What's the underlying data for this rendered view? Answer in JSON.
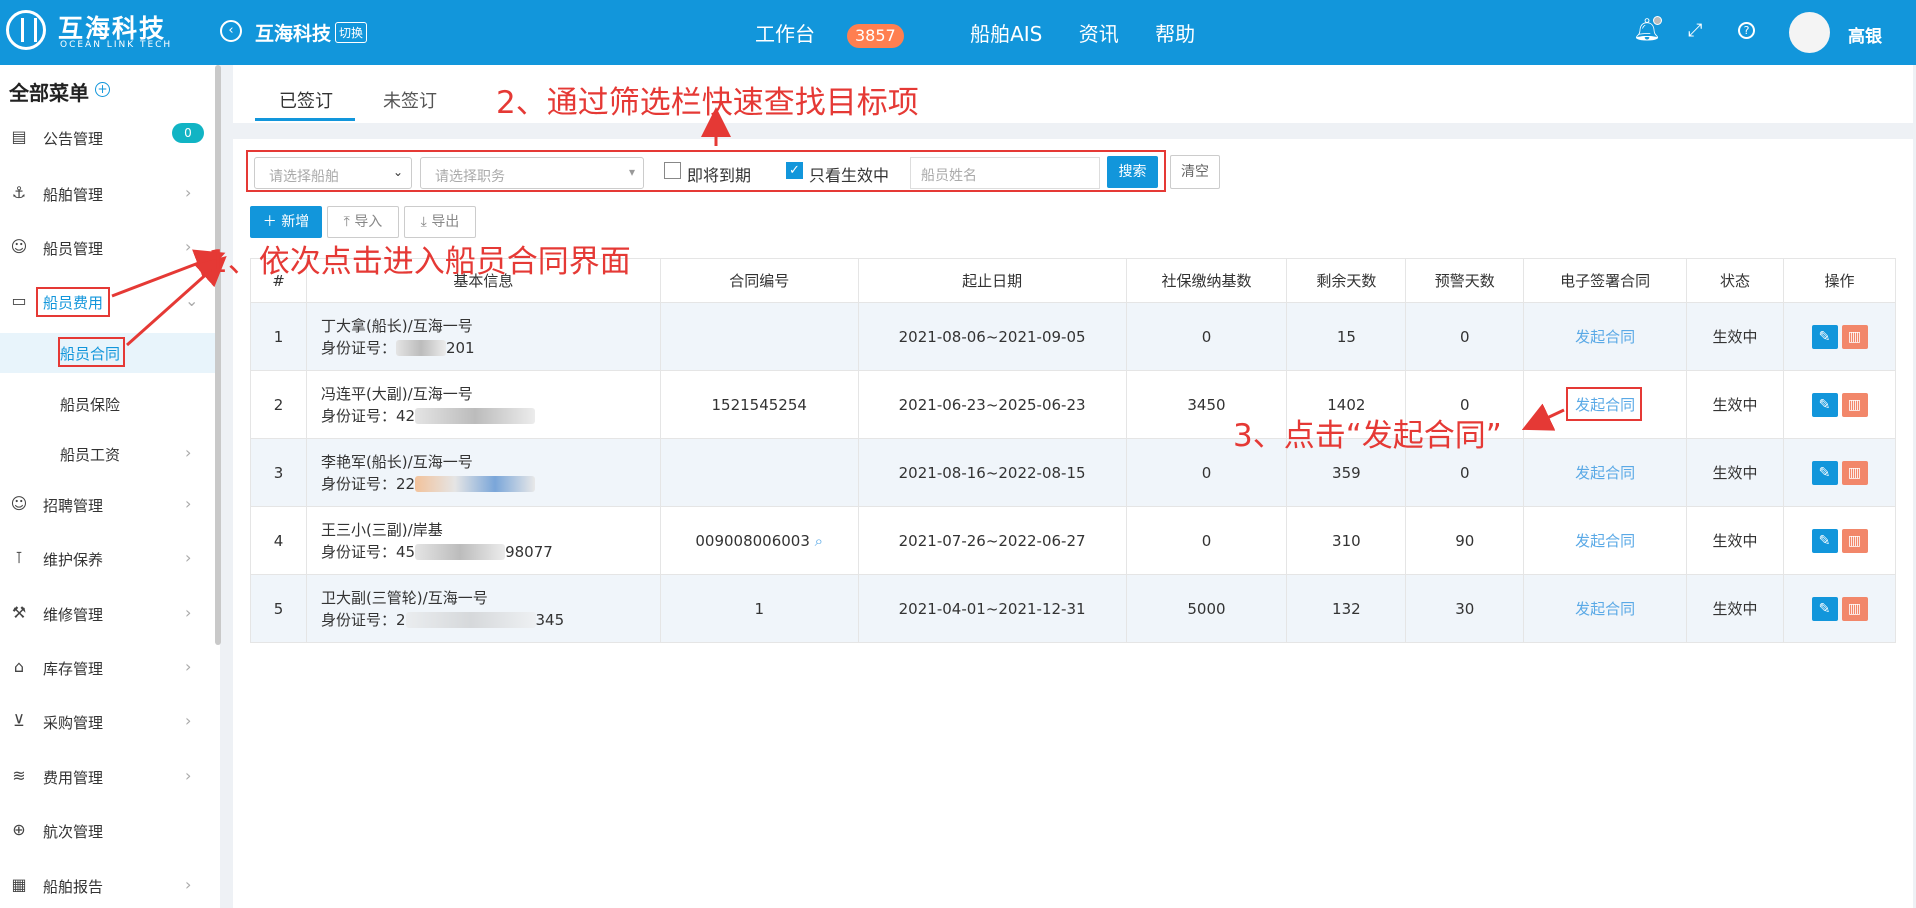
{
  "header": {
    "brand": "互海科技",
    "brand_sub": "OCEAN LINK TECH",
    "company": "互海科技",
    "switch_label": "切换",
    "nav": [
      {
        "label": "工作台",
        "badge": "3857"
      },
      {
        "label": "船舶AIS"
      },
      {
        "label": "资讯"
      },
      {
        "label": "帮助"
      }
    ],
    "username": "高银",
    "icons": {
      "back": "back-circle-icon",
      "bell": "bell-icon",
      "expand": "expand-icon",
      "help": "help-icon"
    }
  },
  "sidebar": {
    "title": "全部菜单",
    "items": [
      {
        "label": "公告管理",
        "icon": "book-icon",
        "badge": "0"
      },
      {
        "label": "船舶管理",
        "icon": "anchor-icon"
      },
      {
        "label": "船员管理",
        "icon": "user-icon"
      },
      {
        "label": "船员费用",
        "icon": "wallet-icon"
      },
      {
        "label": "船员合同"
      },
      {
        "label": "船员保险"
      },
      {
        "label": "船员工资"
      },
      {
        "label": "招聘管理",
        "icon": "recruit-icon"
      },
      {
        "label": "维护保养",
        "icon": "maintain-icon"
      },
      {
        "label": "维修管理",
        "icon": "wrench-icon"
      },
      {
        "label": "库存管理",
        "icon": "home-icon"
      },
      {
        "label": "采购管理",
        "icon": "cart-icon"
      },
      {
        "label": "费用管理",
        "icon": "coins-icon"
      },
      {
        "label": "航次管理",
        "icon": "globe-icon"
      },
      {
        "label": "船舶报告",
        "icon": "report-icon"
      }
    ]
  },
  "tabs": [
    "已签订",
    "未签订"
  ],
  "filters": {
    "ship_placeholder": "请选择船舶",
    "duty_placeholder": "请选择职务",
    "expiring_label": "即将到期",
    "active_only_label": "只看生效中",
    "name_placeholder": "船员姓名",
    "search_label": "搜索",
    "clear_label": "清空"
  },
  "actions": {
    "add": "新增",
    "import": "导入",
    "export": "导出"
  },
  "table": {
    "headers": [
      "#",
      "基本信息",
      "合同编号",
      "起止日期",
      "社保缴纳基数",
      "剩余天数",
      "预警天数",
      "电子签署合同",
      "状态",
      "操作"
    ],
    "rows": [
      {
        "no": "1",
        "name": "丁大拿(船长)/互海一号",
        "id_label": "身份证号：",
        "id_tail": "201",
        "contract": "",
        "period": "2021-08-06~2021-09-05",
        "social": "0",
        "remain": "15",
        "warn": "0",
        "esign": "发起合同",
        "status": "生效中"
      },
      {
        "no": "2",
        "name": "冯连平(大副)/互海一号",
        "id_label": "身份证号：",
        "id_head": "42",
        "contract": "1521545254",
        "period": "2021-06-23~2025-06-23",
        "social": "3450",
        "remain": "1402",
        "warn": "0",
        "esign": "发起合同",
        "status": "生效中"
      },
      {
        "no": "3",
        "name": "李艳军(船长)/互海一号",
        "id_label": "身份证号：",
        "id_head": "22",
        "contract": "",
        "period": "2021-08-16~2022-08-15",
        "social": "0",
        "remain": "359",
        "warn": "0",
        "esign": "发起合同",
        "status": "生效中"
      },
      {
        "no": "4",
        "name": "王三小(三副)/岸基",
        "id_label": "身份证号：",
        "id_head": "45",
        "id_tail": "98077",
        "contract": "009008006003",
        "period": "2021-07-26~2022-06-27",
        "social": "0",
        "remain": "310",
        "warn": "90",
        "esign": "发起合同",
        "status": "生效中"
      },
      {
        "no": "5",
        "name": "卫大副(三管轮)/互海一号",
        "id_label": "身份证号：",
        "id_head": "2",
        "id_tail": "345",
        "contract": "1",
        "period": "2021-04-01~2021-12-31",
        "social": "5000",
        "remain": "132",
        "warn": "30",
        "esign": "发起合同",
        "status": "生效中"
      }
    ]
  },
  "annotations": {
    "step1": "1、依次点击进入船员合同界面",
    "step2": "2、通过筛选栏快速查找目标项",
    "step3": "3、点击“发起合同”"
  },
  "colors": {
    "primary": "#1296db",
    "annotation": "#e53935",
    "delete": "#f2876a"
  }
}
